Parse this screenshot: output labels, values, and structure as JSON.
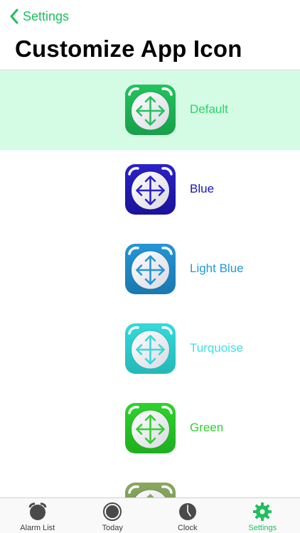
{
  "nav": {
    "back_label": "Settings"
  },
  "page": {
    "title": "Customize App Icon"
  },
  "icons": [
    {
      "name": "Default",
      "color": "#22c35e",
      "dark": "#17a04a",
      "label_color": "#2bd36a",
      "selected": true
    },
    {
      "name": "Blue",
      "color": "#2b22c8",
      "dark": "#1a139a",
      "label_color": "#1a14b8",
      "selected": false
    },
    {
      "name": "Light Blue",
      "color": "#2396d6",
      "dark": "#1a78b0",
      "label_color": "#2299dd",
      "selected": false
    },
    {
      "name": "Turquoise",
      "color": "#35dada",
      "dark": "#24b8b8",
      "label_color": "#3ee0e6",
      "selected": false
    },
    {
      "name": "Green",
      "color": "#2dd42d",
      "dark": "#1fae1f",
      "label_color": "#2bd42b",
      "selected": false
    },
    {
      "name": "",
      "color": "#8aa860",
      "dark": "#6f8c48",
      "label_color": "#7a9a50",
      "selected": false
    }
  ],
  "tabs": [
    {
      "label": "Alarm List",
      "icon": "alarm-clock-icon",
      "active": false
    },
    {
      "label": "Today",
      "icon": "today-circle-icon",
      "active": false
    },
    {
      "label": "Clock",
      "icon": "clock-icon",
      "active": false
    },
    {
      "label": "Settings",
      "icon": "gear-icon",
      "active": true
    }
  ],
  "colors": {
    "accent": "#1fbf5f",
    "tab_icon": "#4a4a4a"
  }
}
